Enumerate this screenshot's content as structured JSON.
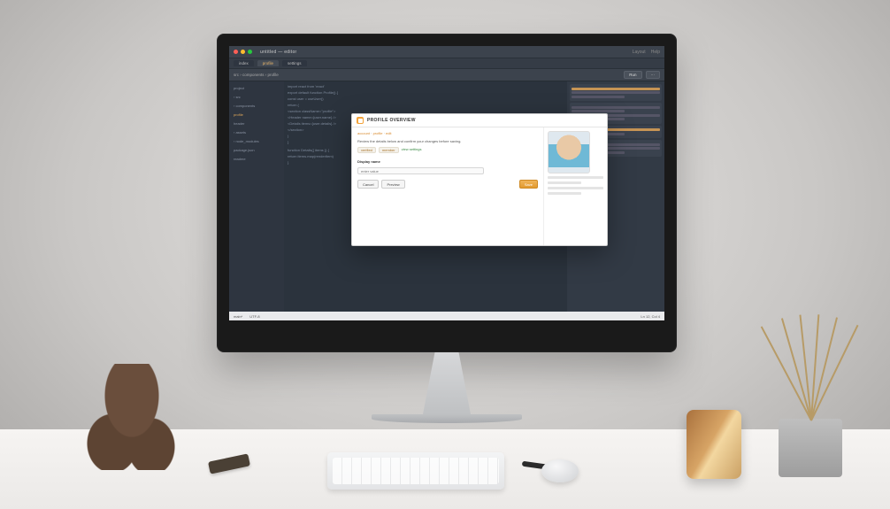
{
  "titlebar": {
    "text": "untitled — editor"
  },
  "titlebar_right": [
    "Layout",
    "Help"
  ],
  "tabs": [
    {
      "label": "index"
    },
    {
      "label": "profile"
    },
    {
      "label": "settings"
    }
  ],
  "active_tab": 1,
  "breadcrumb": "src › components › profile",
  "toolbar": {
    "run": "Run",
    "more": "···"
  },
  "sidebar": {
    "items": [
      "project",
      "› src",
      "  › components",
      "    profile",
      "    header",
      "  › assets",
      "› node_modules",
      "package.json",
      "readme"
    ],
    "highlight_index": 3
  },
  "code_lines": [
    "import react from 'react'",
    "export default function Profile() {",
    "  const user = useUser()",
    "  return (",
    "    <section className=\"profile\">",
    "      <Header name={user.name} />",
    "      <Details items={user.details} />",
    "    </section>",
    "  )",
    "}",
    "",
    "function Details({ items }) {",
    "  return items.map(renderItem)",
    "}"
  ],
  "panel_right": {
    "blocks": 4
  },
  "statusbar": {
    "left": "main*",
    "mid": "UTF-8",
    "right": "Ln 12, Col 4"
  },
  "dialog": {
    "title": "PROFILE OVERVIEW",
    "crumb_segments": [
      "account",
      "profile",
      "edit"
    ],
    "description": "Review the details below and confirm your changes before saving.",
    "chips": [
      "verified",
      "member"
    ],
    "link": "view settings",
    "section_label": "Display name",
    "input_value": "",
    "input_placeholder": "enter value",
    "buttons": {
      "cancel": "Cancel",
      "secondary": "Preview",
      "primary": "Save"
    }
  }
}
